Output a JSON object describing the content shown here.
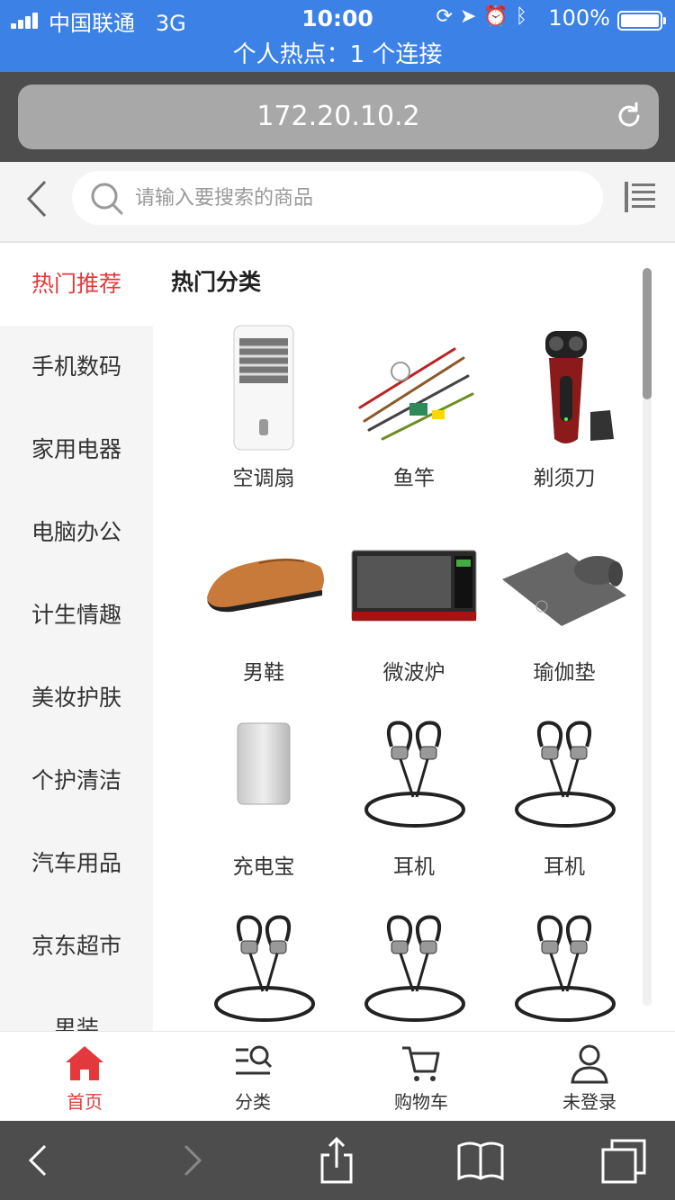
{
  "status": {
    "carrier": "中国联通",
    "network": "3G",
    "time": "10:00",
    "battery": "100%",
    "hotspot": "个人热点：1 个连接"
  },
  "browser": {
    "url": "172.20.10.2"
  },
  "search": {
    "placeholder": "请输入要搜索的商品"
  },
  "sidebar": {
    "items": [
      {
        "label": "热门推荐"
      },
      {
        "label": "手机数码"
      },
      {
        "label": "家用电器"
      },
      {
        "label": "电脑办公"
      },
      {
        "label": "计生情趣"
      },
      {
        "label": "美妆护肤"
      },
      {
        "label": "个护清洁"
      },
      {
        "label": "汽车用品"
      },
      {
        "label": "京东超市"
      },
      {
        "label": "男装"
      }
    ]
  },
  "main": {
    "section_title": "热门分类",
    "products": [
      {
        "label": "空调扇"
      },
      {
        "label": "鱼竿"
      },
      {
        "label": "剃须刀"
      },
      {
        "label": "男鞋"
      },
      {
        "label": "微波炉"
      },
      {
        "label": "瑜伽垫"
      },
      {
        "label": "充电宝"
      },
      {
        "label": "耳机"
      },
      {
        "label": "耳机"
      },
      {
        "label": ""
      },
      {
        "label": ""
      },
      {
        "label": ""
      }
    ]
  },
  "tabbar": {
    "items": [
      {
        "label": "首页"
      },
      {
        "label": "分类"
      },
      {
        "label": "购物车"
      },
      {
        "label": "未登录"
      }
    ]
  },
  "colors": {
    "accent": "#e4393c",
    "status_bar": "#3c82e6",
    "browser_chrome": "#4d4d4d"
  }
}
